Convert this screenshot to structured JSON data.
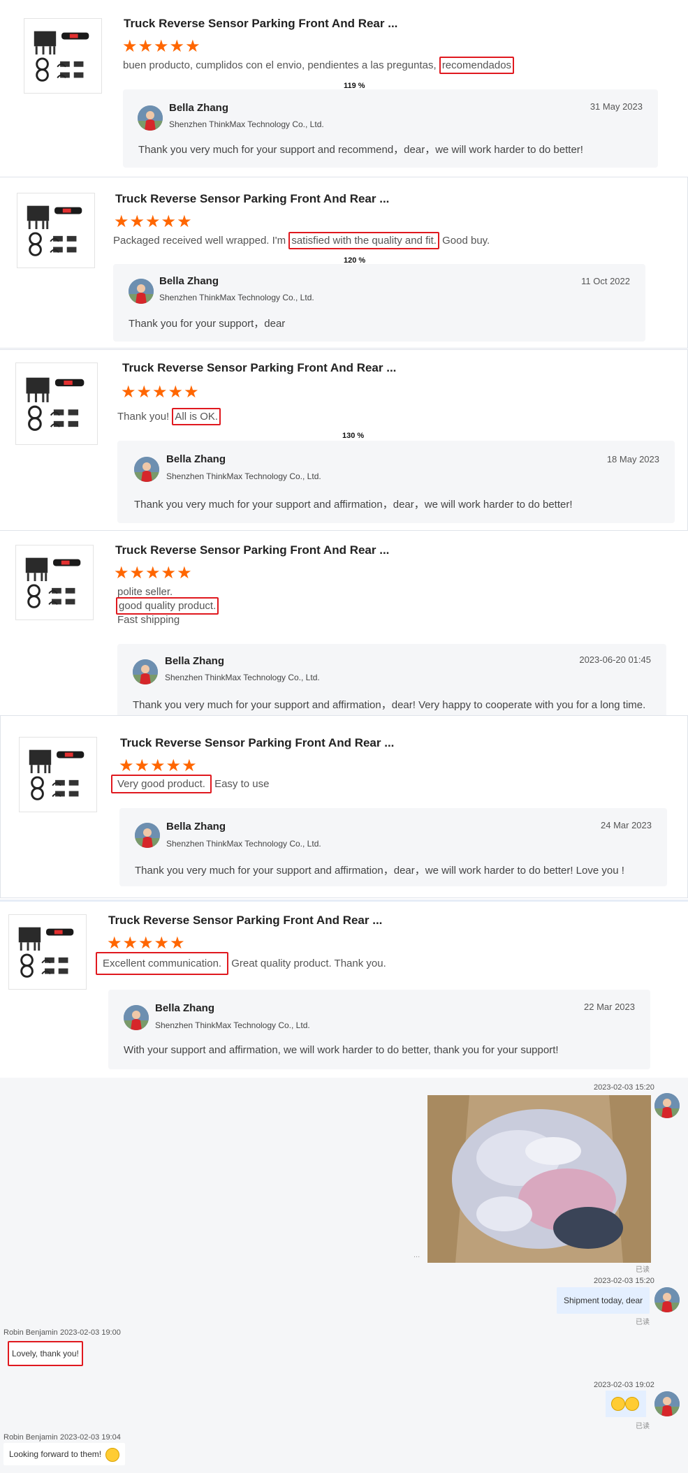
{
  "product_title": "Truck Reverse Sensor Parking Front And Rear ...",
  "stars": "★★★★★",
  "reply_name": "Bella Zhang",
  "reply_company": "Shenzhen ThinkMax Technology Co., Ltd.",
  "reviews": [
    {
      "pre": "buen producto, cumplidos con el envio, pendientes a las preguntas, ",
      "highlight": "recomendados",
      "post": "",
      "zoom": "119 %",
      "date": "31 May 2023",
      "reply": "Thank you very much for your support and recommend，dear，we will work harder to do better!"
    },
    {
      "pre": "Packaged received well wrapped. I'm ",
      "highlight": "satisfied with the quality and fit.",
      "post": " Good buy.",
      "zoom": "120 %",
      "date": "11 Oct 2022",
      "reply": "Thank you for your support，dear"
    },
    {
      "pre": "Thank you! ",
      "highlight": "All is OK.",
      "post": "",
      "zoom": "130 %",
      "date": "18 May 2023",
      "reply": "Thank you very much for your support and affirmation，dear，we will work harder to do better!"
    },
    {
      "line1": "polite seller.",
      "highlight": "good quality product.",
      "line3": "Fast shipping",
      "date": "2023-06-20 01:45",
      "reply": "Thank you very much for your support and affirmation，dear! Very happy to cooperate with you for a long time."
    },
    {
      "pre": "",
      "highlight": "Very good product.",
      "post": " Easy to use",
      "date": "24 Mar 2023",
      "reply": "Thank you very much for your support and affirmation，dear，we will work harder to do better!  Love you !"
    },
    {
      "pre": "",
      "highlight": "Excellent communication.",
      "post": " Great quality product.  Thank you.",
      "date": "22 Mar 2023",
      "reply": "With your support and affirmation, we will work harder to do better, thank you for your support!"
    }
  ],
  "chat": {
    "ts1": "2023-02-03 15:20",
    "read": "已读",
    "dots": "...",
    "ts2": "2023-02-03 15:20",
    "msg_shipment": "Shipment today, dear",
    "buyer": "Robin Benjamin",
    "ts3": "2023-02-03 19:00",
    "msg_lovely": "Lovely, thank you!",
    "ts4": "2023-02-03 19:02",
    "ts5": "2023-02-03 19:04",
    "msg_forward": "Looking forward to them!"
  },
  "colors": {
    "star": "#ff6600",
    "highlight_border": "#e0191f",
    "chat_bubble": "#e4efff"
  }
}
